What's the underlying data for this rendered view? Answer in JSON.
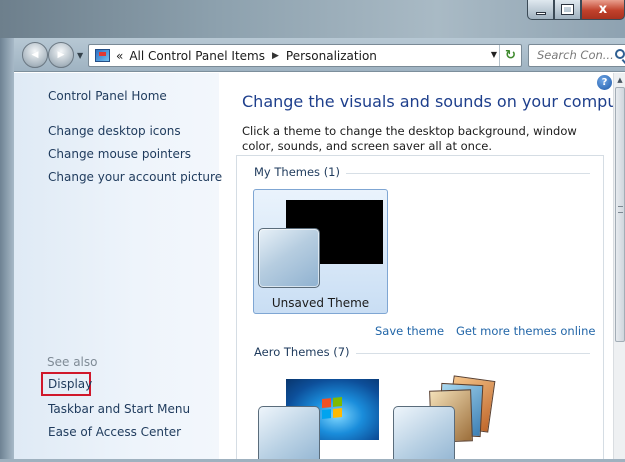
{
  "window": {
    "minimize_icon": "minimize-icon",
    "maximize_icon": "maximize-icon",
    "close_glyph": "x"
  },
  "navigation": {
    "back_glyph": "◀",
    "forward_glyph": "▶",
    "recent_dropdown_glyph": "▼",
    "address": {
      "prefix": "«",
      "segments": [
        "All Control Panel Items",
        "Personalization"
      ],
      "separator": "▶",
      "dropdown_glyph": "▼",
      "refresh_glyph": "↻"
    },
    "search": {
      "placeholder": "Search Con..."
    }
  },
  "sidebar": {
    "home": "Control Panel Home",
    "links": [
      "Change desktop icons",
      "Change mouse pointers",
      "Change your account picture"
    ],
    "see_also_heading": "See also",
    "see_also_links": [
      "Display",
      "Taskbar and Start Menu",
      "Ease of Access Center"
    ],
    "highlighted_link_color": "#d0182b"
  },
  "main": {
    "help_glyph": "?",
    "title": "Change the visuals and sounds on your computer",
    "description": "Click a theme to change the desktop background, window color, sounds, and screen saver all at once.",
    "my_themes_heading": "My Themes (1)",
    "selected_theme_name": "Unsaved Theme",
    "save_theme_link": "Save theme",
    "get_more_link": "Get more themes online",
    "aero_themes_heading": "Aero Themes (7)"
  },
  "scrollbar": {
    "up_glyph": "▲"
  },
  "colors": {
    "title_blue": "#1e3f8c",
    "link_blue": "#2266a8",
    "sidebar_bg": "#eef4fb"
  }
}
